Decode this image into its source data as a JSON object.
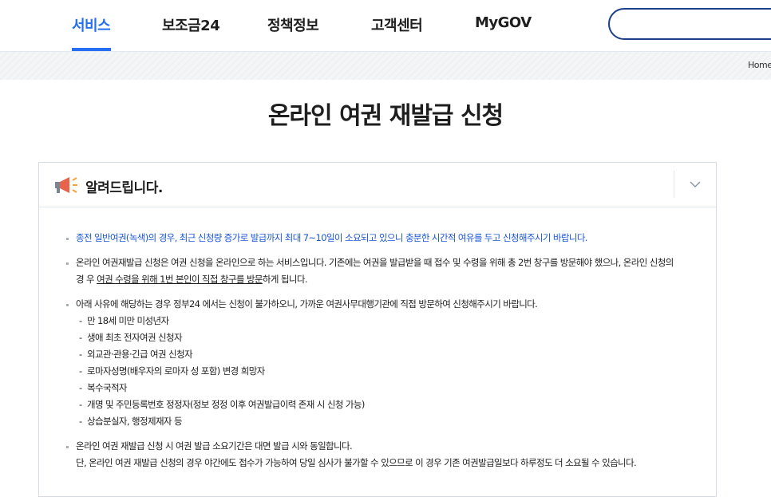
{
  "nav": {
    "items": [
      {
        "label": "서비스",
        "active": true
      },
      {
        "label": "보조금24",
        "active": false
      },
      {
        "label": "정책정보",
        "active": false
      },
      {
        "label": "고객센터",
        "active": false
      },
      {
        "label": "MyGOV",
        "active": false
      }
    ],
    "search": {
      "placeholder": "",
      "value": ""
    }
  },
  "breadcrumb": {
    "home": "Home"
  },
  "page": {
    "title": "온라인 여권 재발급 신청"
  },
  "notice": {
    "heading": "알려드립니다.",
    "items": [
      {
        "text": "종전 일반여권(녹색)의 경우, 최근 신청량 증가로 발급까지 최대 7~10일이 소요되고 있으니 충분한 시간적 여유를 두고 신청해주시기 바랍니다.",
        "highlight": true
      },
      {
        "text_line1": "온라인 여권재발급 신청은 여권 신청을 온라인으로 하는 서비스입니다. 기존에는 여권을 발급받을 때 접수 및 수령을 위해 총 2번 창구를 방문해야 했으나, 온라인 신청의 경",
        "text_line2_pre": "우 ",
        "text_line2_underline": "여권 수령을 위해 1번 본인이 직접 창구를 방문",
        "text_line2_post": "하게 됩니다."
      },
      {
        "text": "아래 사유에 해당하는 경우 정부24 에서는 신청이 불가하오니, 가까운 여권사무대행기관에 직접 방문하여 신청해주시기 바랍니다.",
        "subitems": [
          "만 18세 미만 미성년자",
          "생애 최초 전자여권 신청자",
          "외교관·관용·긴급 여권 신청자",
          "로마자성명(배우자의 로마자 성 포함) 변경 희망자",
          "복수국적자",
          "개명 및 주민등록번호 정정자(정보 정정 이후 여권발급이력 존재 시 신청 가능)",
          "상습분실자, 행정제재자 등"
        ]
      },
      {
        "text_line1": "온라인 여권 재발급 신청 시 여권 발급 소요기간은 대면 발급 시와 동일합니다.",
        "text_line2": "단, 온라인 여권 재발급 신청의 경우 야간에도 접수가 가능하여 당일 심사가 불가할 수 있으므로 이 경우 기존 여권발급일보다 하루정도 더 소요될 수 있습니다."
      }
    ]
  },
  "colors": {
    "accent": "#256ef4",
    "highlight_text": "#1a56d6",
    "search_border": "#1d3f8a"
  },
  "icons": {
    "notice": "megaphone-icon",
    "toggle": "chevron-down-icon"
  }
}
